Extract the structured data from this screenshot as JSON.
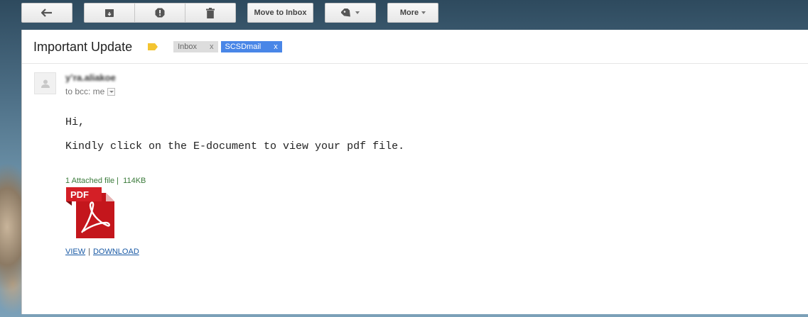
{
  "toolbar": {
    "move_to_inbox_label": "Move to Inbox",
    "more_label": "More"
  },
  "email": {
    "subject": "Important Update",
    "labels": [
      {
        "name": "Inbox",
        "remove": "x",
        "color": "#dddddd"
      },
      {
        "name": "SCSDmail",
        "remove": "x",
        "color": "#4986e7"
      }
    ],
    "sender": "y’ra.aliakoe",
    "to_line": "to bcc: me",
    "body_lines": [
      "Hi,",
      "Kindly click on the E-document to view your pdf file."
    ],
    "attachment": {
      "count_text": "1  Attached file |",
      "size": "114KB",
      "icon_label": "PDF",
      "view_label": "VIEW",
      "separator": "|",
      "download_label": "DOWNLOAD"
    }
  },
  "icons": {
    "back": "reply-arrow-icon",
    "archive": "archive-icon",
    "spam": "report-spam-icon",
    "delete": "trash-icon",
    "labels": "label-tag-icon",
    "avatar": "person-icon",
    "label_marker": "important-marker-icon",
    "attachment": "pdf-file-icon"
  },
  "colors": {
    "important_marker": "#f3c431",
    "label_scsd": "#4986e7",
    "pdf_red": "#c4161c",
    "link": "#1a5aa5"
  }
}
